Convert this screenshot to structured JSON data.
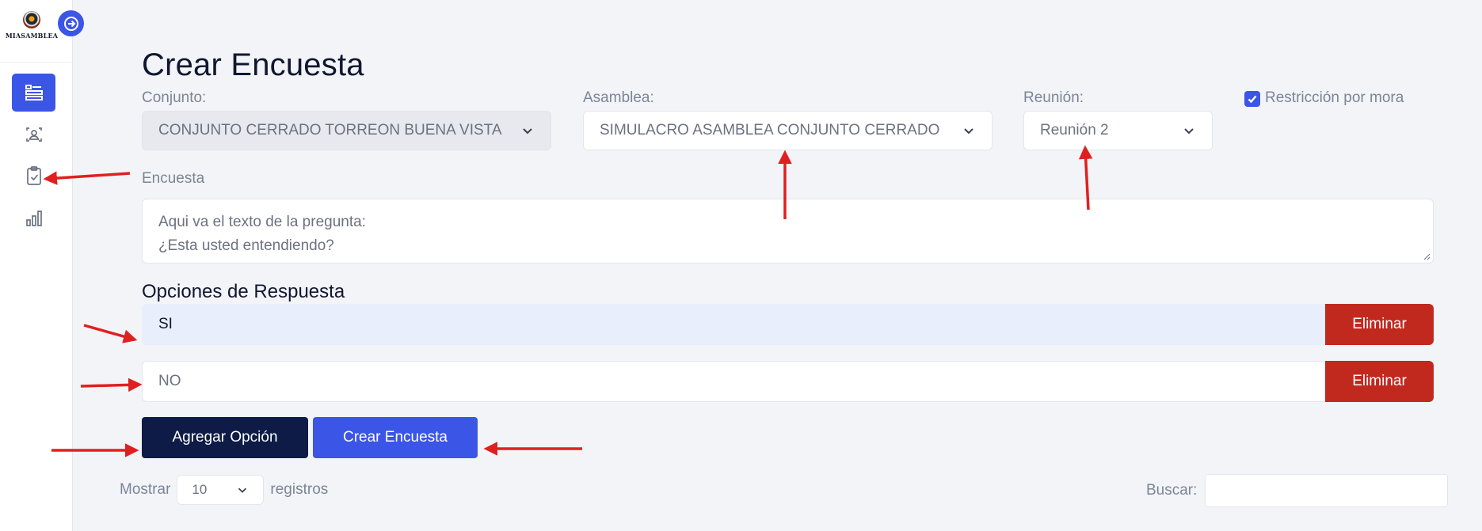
{
  "brand": {
    "logo_text": "MIASAMBLEA"
  },
  "sidebar": {
    "items": [
      {
        "name": "dashboard",
        "icon": "list-icon",
        "active": true
      },
      {
        "name": "users",
        "icon": "user-card-icon",
        "active": false
      },
      {
        "name": "surveys",
        "icon": "clipboard-check-icon",
        "active": false
      },
      {
        "name": "reports",
        "icon": "bar-chart-icon",
        "active": false
      }
    ]
  },
  "page": {
    "title": "Crear Encuesta"
  },
  "form": {
    "conjunto": {
      "label": "Conjunto:",
      "value": "CONJUNTO CERRADO TORREON BUENA VISTA"
    },
    "asamblea": {
      "label": "Asamblea:",
      "value": "SIMULACRO ASAMBLEA CONJUNTO CERRADO"
    },
    "reunion": {
      "label": "Reunión:",
      "value": "Reunión 2"
    },
    "restriccion": {
      "label": "Restricción por mora",
      "checked": true
    },
    "encuesta": {
      "label": "Encuesta",
      "placeholder_line1": "Aqui va el texto de la pregunta:",
      "placeholder_line2": "¿Esta usted entendiendo?"
    }
  },
  "options_section": {
    "title": "Opciones de Respuesta",
    "options": [
      {
        "value": "SI",
        "delete_label": "Eliminar"
      },
      {
        "value": "NO",
        "delete_label": "Eliminar"
      }
    ]
  },
  "actions": {
    "add_option": "Agregar Opción",
    "create_survey": "Crear Encuesta"
  },
  "table_controls": {
    "show_label": "Mostrar",
    "show_value": "10",
    "records_label": "registros",
    "search_label": "Buscar:"
  },
  "colors": {
    "primary": "#3b55e6",
    "dark": "#0e1b46",
    "danger": "#c1291f",
    "annotation": "#e02020"
  }
}
